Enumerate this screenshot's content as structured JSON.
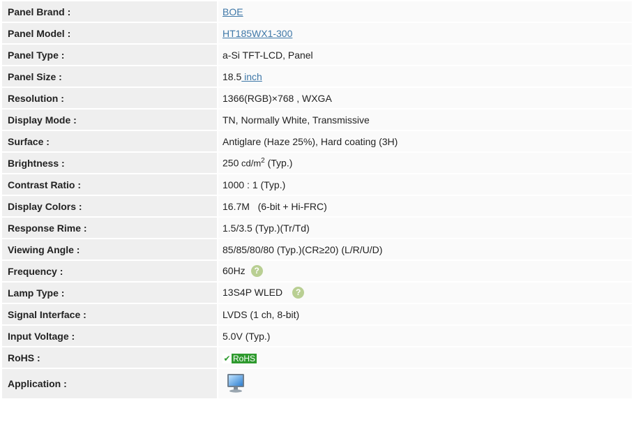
{
  "rows": [
    {
      "label": "Panel Brand :",
      "value": "BOE"
    },
    {
      "label": "Panel Model :",
      "value": "HT185WX1-300"
    },
    {
      "label": "Panel Type :",
      "value": "a-Si TFT-LCD, Panel"
    },
    {
      "label": "Panel Size :",
      "value": "18.5",
      "unit": " inch"
    },
    {
      "label": "Resolution :",
      "value": "1366(RGB)×768 , WXGA"
    },
    {
      "label": "Display Mode :",
      "value": "TN, Normally White, Transmissive"
    },
    {
      "label": "Surface :",
      "value": "Antiglare (Haze 25%), Hard coating (3H)"
    },
    {
      "label": "Brightness :",
      "value": "250",
      "unit": " cd/m",
      "sup": "2",
      "suffix": " (Typ.)"
    },
    {
      "label": "Contrast Ratio :",
      "value": "1000 : 1 (Typ.)"
    },
    {
      "label": "Display Colors :",
      "value": "16.7M   (6-bit + Hi-FRC)"
    },
    {
      "label": "Response Rime :",
      "value": "1.5/3.5 (Typ.)(Tr/Td)"
    },
    {
      "label": "Viewing Angle :",
      "value": "85/85/80/80 (Typ.)(CR≥20) (L/R/U/D)"
    },
    {
      "label": "Frequency :",
      "value": "60Hz",
      "help": "?"
    },
    {
      "label": "Lamp Type :",
      "value": "13S4P WLED",
      "help": "?"
    },
    {
      "label": "Signal Interface :",
      "value": "LVDS (1 ch, 8-bit)"
    },
    {
      "label": "Input Voltage :",
      "value": "5.0V (Typ.)"
    },
    {
      "label": "RoHS :",
      "badge_check": "✔",
      "badge_text": "RoHS"
    },
    {
      "label": "Application :",
      "icon": "monitor-icon"
    }
  ],
  "colors": {
    "label_bg": "#efefef",
    "value_bg": "#fafafa",
    "link": "#3f78a8",
    "help": "#b9cf93",
    "rohs": "#2e9a2e"
  }
}
